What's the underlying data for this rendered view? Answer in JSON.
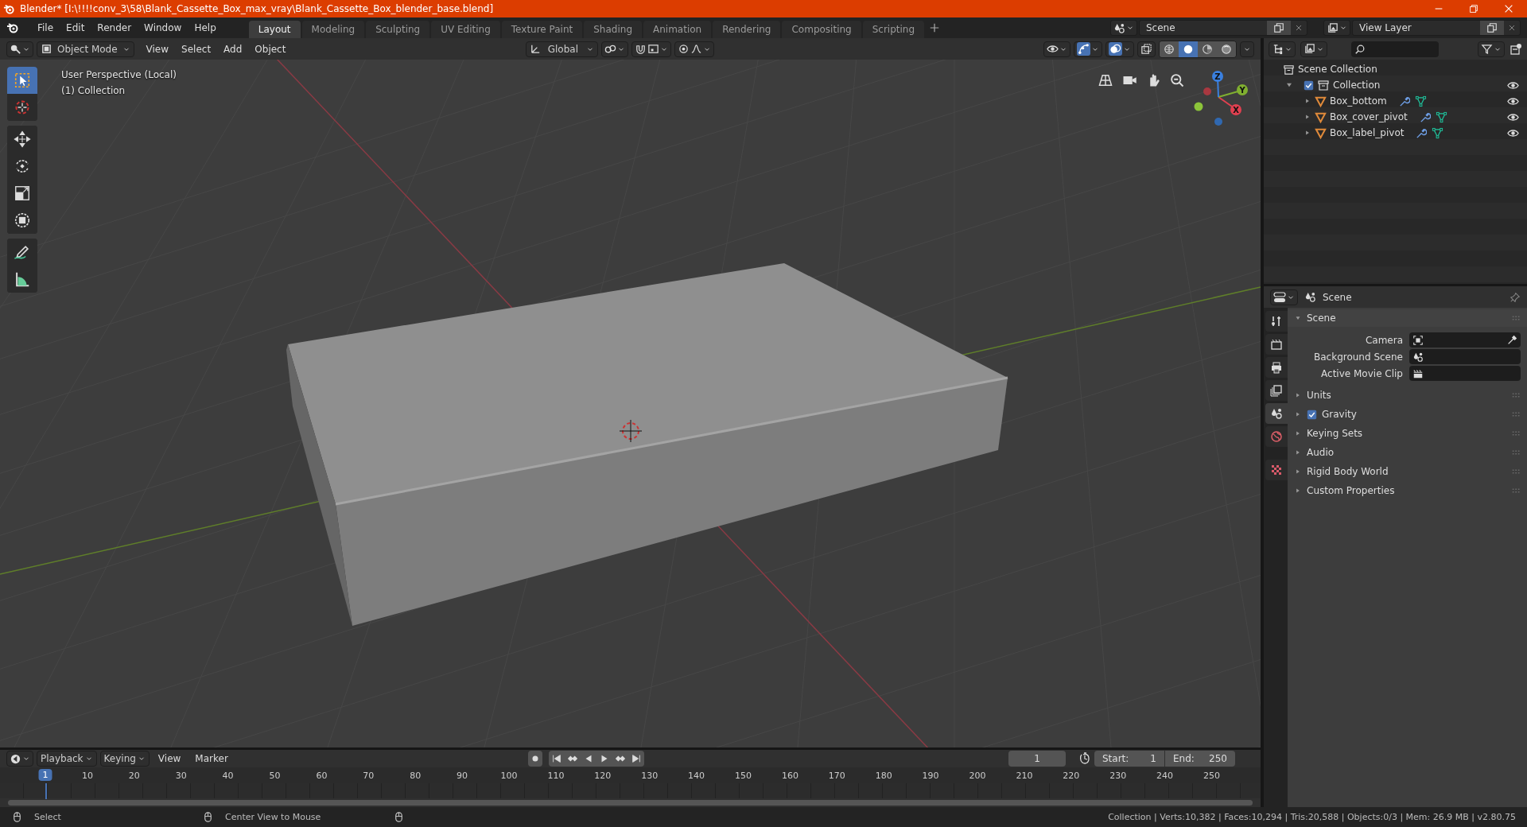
{
  "window": {
    "title": "Blender* [I:\\!!!!conv_3\\58\\Blank_Cassette_Box_max_vray\\Blank_Cassette_Box_blender_base.blend]"
  },
  "menu": [
    "File",
    "Edit",
    "Render",
    "Window",
    "Help"
  ],
  "workspaces": [
    {
      "label": "Layout",
      "selected": true
    },
    {
      "label": "Modeling",
      "selected": false
    },
    {
      "label": "Sculpting",
      "selected": false
    },
    {
      "label": "UV Editing",
      "selected": false
    },
    {
      "label": "Texture Paint",
      "selected": false
    },
    {
      "label": "Shading",
      "selected": false
    },
    {
      "label": "Animation",
      "selected": false
    },
    {
      "label": "Rendering",
      "selected": false
    },
    {
      "label": "Compositing",
      "selected": false
    },
    {
      "label": "Scripting",
      "selected": false
    }
  ],
  "scene": {
    "name": "Scene"
  },
  "view_layer": {
    "name": "View Layer"
  },
  "viewport": {
    "mode": "Object Mode",
    "menus": [
      "View",
      "Select",
      "Add",
      "Object"
    ],
    "orientation": "Global",
    "overlay_text": [
      "User Perspective (Local)",
      "(1) Collection"
    ],
    "tools": [
      {
        "kind": "select",
        "selected": true
      },
      {
        "kind": "cursor",
        "selected": false
      },
      {
        "kind": "move",
        "selected": false
      },
      {
        "kind": "rotate",
        "selected": false
      },
      {
        "kind": "scale",
        "selected": false
      },
      {
        "kind": "transform",
        "selected": false
      },
      {
        "kind": "annotate",
        "selected": false
      },
      {
        "kind": "measure",
        "selected": false
      }
    ],
    "shading": [
      {
        "kind": "wireframe",
        "selected": false
      },
      {
        "kind": "solid",
        "selected": true
      },
      {
        "kind": "material",
        "selected": false
      },
      {
        "kind": "rendered",
        "selected": false
      }
    ],
    "toggles": [
      {
        "kind": "gizmo",
        "on": true
      },
      {
        "kind": "overlay",
        "on": true
      }
    ],
    "gizmo_axes": [
      "X",
      "Y",
      "Z"
    ]
  },
  "outliner": {
    "root": "Scene Collection",
    "items": [
      {
        "label": "Collection",
        "checked": true,
        "expanded": true,
        "children": [
          {
            "label": "Box_bottom",
            "expanded": false
          },
          {
            "label": "Box_cover_pivot",
            "expanded": false
          },
          {
            "label": "Box_label_pivot",
            "expanded": false
          }
        ]
      }
    ]
  },
  "properties": {
    "context": "Scene",
    "tabs": [
      {
        "kind": "tool",
        "selected": false
      },
      {
        "kind": "render",
        "selected": false
      },
      {
        "kind": "output",
        "selected": false
      },
      {
        "kind": "view_layer",
        "selected": false
      },
      {
        "kind": "scene",
        "selected": true
      },
      {
        "kind": "world",
        "selected": false
      },
      {
        "kind": "texture",
        "selected": false
      }
    ],
    "panels": [
      {
        "label": "Scene",
        "expanded": true,
        "fields": [
          {
            "label": "Camera",
            "kind": "camera"
          },
          {
            "label": "Background Scene",
            "kind": "scene"
          },
          {
            "label": "Active Movie Clip",
            "kind": "clip"
          }
        ]
      },
      {
        "label": "Units",
        "expanded": false
      },
      {
        "label": "Gravity",
        "expanded": false,
        "checked": true
      },
      {
        "label": "Keying Sets",
        "expanded": false
      },
      {
        "label": "Audio",
        "expanded": false
      },
      {
        "label": "Rigid Body World",
        "expanded": false
      },
      {
        "label": "Custom Properties",
        "expanded": false
      }
    ]
  },
  "timeline": {
    "menus": [
      "Playback",
      "Keying",
      "View",
      "Marker"
    ],
    "current_frame": "1",
    "start_label": "Start:",
    "start": "1",
    "end_label": "End:",
    "end": "250",
    "playhead": "1",
    "ruler": [
      "10",
      "20",
      "30",
      "40",
      "50",
      "60",
      "70",
      "80",
      "90",
      "100",
      "110",
      "120",
      "130",
      "140",
      "150",
      "160",
      "170",
      "180",
      "190",
      "200",
      "210",
      "220",
      "230",
      "240",
      "250"
    ]
  },
  "status_bar": {
    "hints": [
      "Select",
      "Center View to Mouse"
    ],
    "stats": "Collection | Verts:10,382 | Faces:10,294 | Tris:20,588 | Objects:0/3 | Mem: 26.9 MB | v2.80.75"
  }
}
